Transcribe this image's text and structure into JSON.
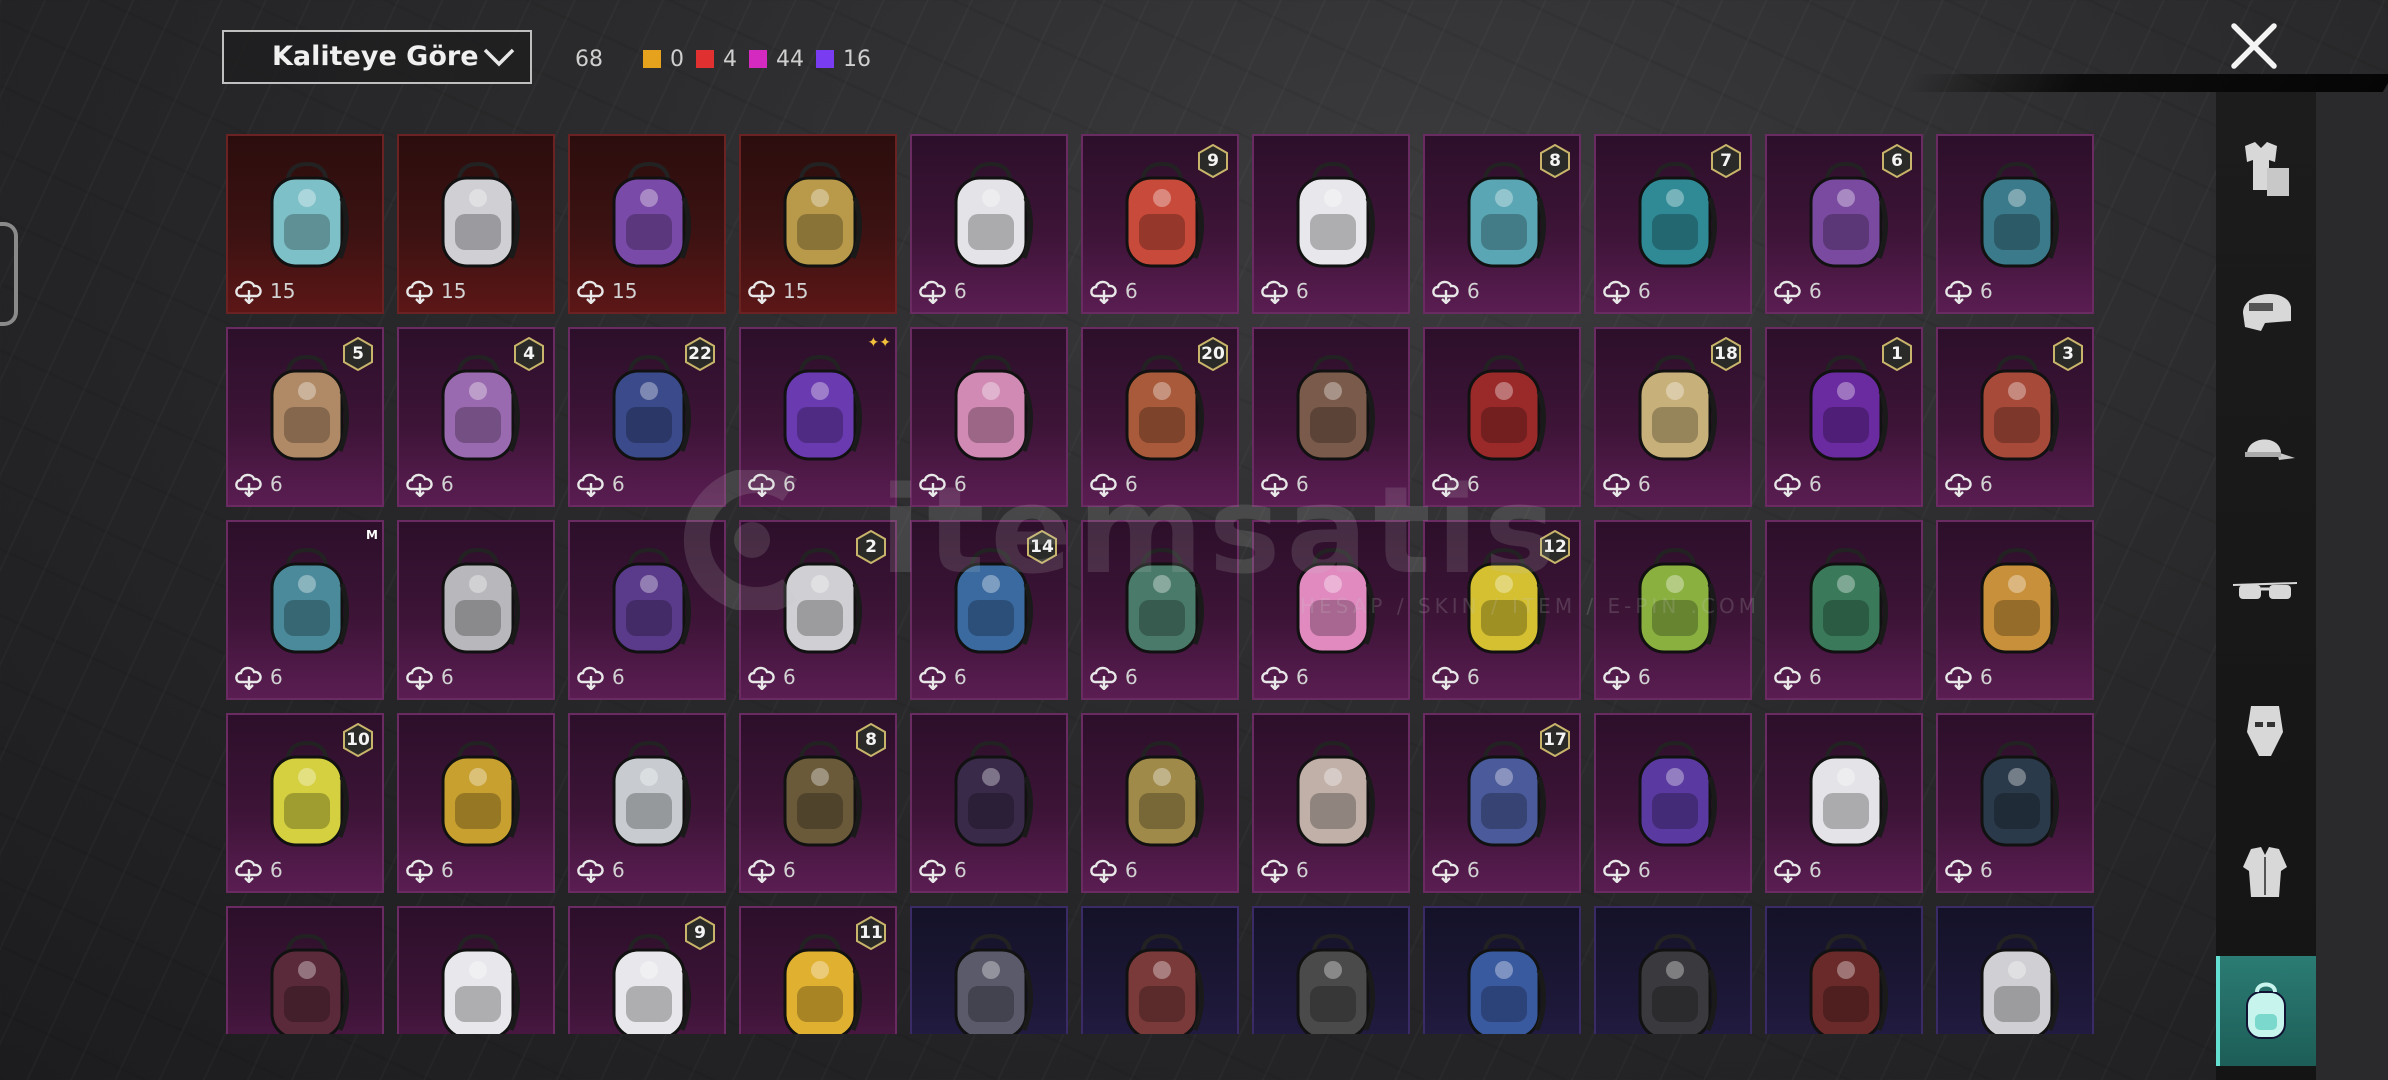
{
  "header": {
    "sort_label": "Kaliteye Göre",
    "total_count": "68",
    "quality_counts": [
      {
        "color": "#e6a21c",
        "value": "0"
      },
      {
        "color": "#e03030",
        "value": "4"
      },
      {
        "color": "#d42ac0",
        "value": "44"
      },
      {
        "color": "#7a3cf0",
        "value": "16"
      }
    ]
  },
  "watermark": {
    "text": "itemsatis",
    "sub": "HESAP / SKIN / ITEM / E-PIN .COM"
  },
  "categories": [
    {
      "icon": "outfit-icon",
      "active": false
    },
    {
      "icon": "helmet-icon",
      "active": false
    },
    {
      "icon": "cap-icon",
      "active": false
    },
    {
      "icon": "glasses-icon",
      "active": false
    },
    {
      "icon": "mask-icon",
      "active": false
    },
    {
      "icon": "jacket-icon",
      "active": false
    },
    {
      "icon": "backpack-icon",
      "active": true
    }
  ],
  "items": [
    {
      "r": 0,
      "c": 0,
      "q": "red",
      "n": "15",
      "bag": "#7ec0c8",
      "badge": ""
    },
    {
      "r": 0,
      "c": 1,
      "q": "red",
      "n": "15",
      "bag": "#cfcfd4",
      "badge": ""
    },
    {
      "r": 0,
      "c": 2,
      "q": "red",
      "n": "15",
      "bag": "#7a4aa8",
      "badge": ""
    },
    {
      "r": 0,
      "c": 3,
      "q": "red",
      "n": "15",
      "bag": "#b89a4a",
      "badge": ""
    },
    {
      "r": 0,
      "c": 4,
      "q": "pink",
      "n": "6",
      "bag": "#e4e4e8",
      "badge": ""
    },
    {
      "r": 0,
      "c": 5,
      "q": "pink",
      "n": "6",
      "bag": "#c84a3a",
      "badge": "9"
    },
    {
      "r": 0,
      "c": 6,
      "q": "pink",
      "n": "6",
      "bag": "#e8e8ec",
      "badge": ""
    },
    {
      "r": 0,
      "c": 7,
      "q": "pink",
      "n": "6",
      "bag": "#5aa6b4",
      "badge": "8"
    },
    {
      "r": 0,
      "c": 8,
      "q": "pink",
      "n": "6",
      "bag": "#2f8a96",
      "badge": "7"
    },
    {
      "r": 0,
      "c": 9,
      "q": "pink",
      "n": "6",
      "bag": "#7a4aa0",
      "badge": "6"
    },
    {
      "r": 0,
      "c": 10,
      "q": "pink",
      "n": "6",
      "bag": "#3b7a8a",
      "badge": ""
    },
    {
      "r": 1,
      "c": 0,
      "q": "pink",
      "n": "6",
      "bag": "#b08a66",
      "badge": "5"
    },
    {
      "r": 1,
      "c": 1,
      "q": "pink",
      "n": "6",
      "bag": "#9a6ab0",
      "badge": "4"
    },
    {
      "r": 1,
      "c": 2,
      "q": "pink",
      "n": "6",
      "bag": "#3a4a8a",
      "badge": "22"
    },
    {
      "r": 1,
      "c": 3,
      "q": "pink",
      "n": "6",
      "bag": "#6a3ab0",
      "badge": "logo"
    },
    {
      "r": 1,
      "c": 4,
      "q": "pink",
      "n": "6",
      "bag": "#d08ab4",
      "badge": ""
    },
    {
      "r": 1,
      "c": 5,
      "q": "pink",
      "n": "6",
      "bag": "#a85a3a",
      "badge": "20"
    },
    {
      "r": 1,
      "c": 6,
      "q": "pink",
      "n": "6",
      "bag": "#7a5a4a",
      "badge": ""
    },
    {
      "r": 1,
      "c": 7,
      "q": "pink",
      "n": "6",
      "bag": "#9a2a2a",
      "badge": ""
    },
    {
      "r": 1,
      "c": 8,
      "q": "pink",
      "n": "6",
      "bag": "#c8b07a",
      "badge": "18"
    },
    {
      "r": 1,
      "c": 9,
      "q": "pink",
      "n": "6",
      "bag": "#6a2aa0",
      "badge": "1"
    },
    {
      "r": 1,
      "c": 10,
      "q": "pink",
      "n": "6",
      "bag": "#a84a3a",
      "badge": "3"
    },
    {
      "r": 2,
      "c": 0,
      "q": "pink",
      "n": "6",
      "bag": "#4a8a9a",
      "badge": "messi"
    },
    {
      "r": 2,
      "c": 1,
      "q": "pink",
      "n": "6",
      "bag": "#b8b8bc",
      "badge": ""
    },
    {
      "r": 2,
      "c": 2,
      "q": "pink",
      "n": "6",
      "bag": "#5a3a8a",
      "badge": ""
    },
    {
      "r": 2,
      "c": 3,
      "q": "pink",
      "n": "6",
      "bag": "#d0d0d4",
      "badge": "2"
    },
    {
      "r": 2,
      "c": 4,
      "q": "pink",
      "n": "6",
      "bag": "#3a6aa0",
      "badge": "14"
    },
    {
      "r": 2,
      "c": 5,
      "q": "pink",
      "n": "6",
      "bag": "#4a7a6a",
      "badge": ""
    },
    {
      "r": 2,
      "c": 6,
      "q": "pink",
      "n": "6",
      "bag": "#e08ac0",
      "badge": ""
    },
    {
      "r": 2,
      "c": 7,
      "q": "pink",
      "n": "6",
      "bag": "#d4c030",
      "badge": "12"
    },
    {
      "r": 2,
      "c": 8,
      "q": "pink",
      "n": "6",
      "bag": "#8ab040",
      "badge": ""
    },
    {
      "r": 2,
      "c": 9,
      "q": "pink",
      "n": "6",
      "bag": "#3a7a5a",
      "badge": ""
    },
    {
      "r": 2,
      "c": 10,
      "q": "pink",
      "n": "6",
      "bag": "#c8903a",
      "badge": ""
    },
    {
      "r": 3,
      "c": 0,
      "q": "pink",
      "n": "6",
      "bag": "#d4d040",
      "badge": "10"
    },
    {
      "r": 3,
      "c": 1,
      "q": "pink",
      "n": "6",
      "bag": "#c8a030",
      "badge": ""
    },
    {
      "r": 3,
      "c": 2,
      "q": "pink",
      "n": "6",
      "bag": "#c8ccd0",
      "badge": ""
    },
    {
      "r": 3,
      "c": 3,
      "q": "pink",
      "n": "6",
      "bag": "#6a5a3a",
      "badge": "8"
    },
    {
      "r": 3,
      "c": 4,
      "q": "pink",
      "n": "6",
      "bag": "#3a2a4a",
      "badge": ""
    },
    {
      "r": 3,
      "c": 5,
      "q": "pink",
      "n": "6",
      "bag": "#a08a4a",
      "badge": ""
    },
    {
      "r": 3,
      "c": 6,
      "q": "pink",
      "n": "6",
      "bag": "#c0b0a8",
      "badge": ""
    },
    {
      "r": 3,
      "c": 7,
      "q": "pink",
      "n": "6",
      "bag": "#4a5a9a",
      "badge": "17"
    },
    {
      "r": 3,
      "c": 8,
      "q": "pink",
      "n": "6",
      "bag": "#5a3aa0",
      "badge": ""
    },
    {
      "r": 3,
      "c": 9,
      "q": "pink",
      "n": "6",
      "bag": "#e4e4e8",
      "badge": ""
    },
    {
      "r": 3,
      "c": 10,
      "q": "pink",
      "n": "6",
      "bag": "#2a3a4a",
      "badge": ""
    },
    {
      "r": 4,
      "c": 0,
      "q": "pink",
      "n": "",
      "bag": "#5a2a3a",
      "badge": ""
    },
    {
      "r": 4,
      "c": 1,
      "q": "pink",
      "n": "",
      "bag": "#e8e8ec",
      "badge": ""
    },
    {
      "r": 4,
      "c": 2,
      "q": "pink",
      "n": "",
      "bag": "#e8e8ec",
      "badge": "9"
    },
    {
      "r": 4,
      "c": 3,
      "q": "pink",
      "n": "",
      "bag": "#e0b030",
      "badge": "11"
    },
    {
      "r": 4,
      "c": 4,
      "q": "purple",
      "n": "",
      "bag": "#5a5a6a",
      "badge": ""
    },
    {
      "r": 4,
      "c": 5,
      "q": "purple",
      "n": "",
      "bag": "#7a3a3a",
      "badge": ""
    },
    {
      "r": 4,
      "c": 6,
      "q": "purple",
      "n": "",
      "bag": "#4a4a4a",
      "badge": ""
    },
    {
      "r": 4,
      "c": 7,
      "q": "purple",
      "n": "",
      "bag": "#3a5aa0",
      "badge": ""
    },
    {
      "r": 4,
      "c": 8,
      "q": "purple",
      "n": "",
      "bag": "#3a3a3e",
      "badge": ""
    },
    {
      "r": 4,
      "c": 9,
      "q": "purple",
      "n": "",
      "bag": "#6a2a2a",
      "badge": ""
    },
    {
      "r": 4,
      "c": 10,
      "q": "purple",
      "n": "",
      "bag": "#d0d0d4",
      "badge": ""
    }
  ]
}
